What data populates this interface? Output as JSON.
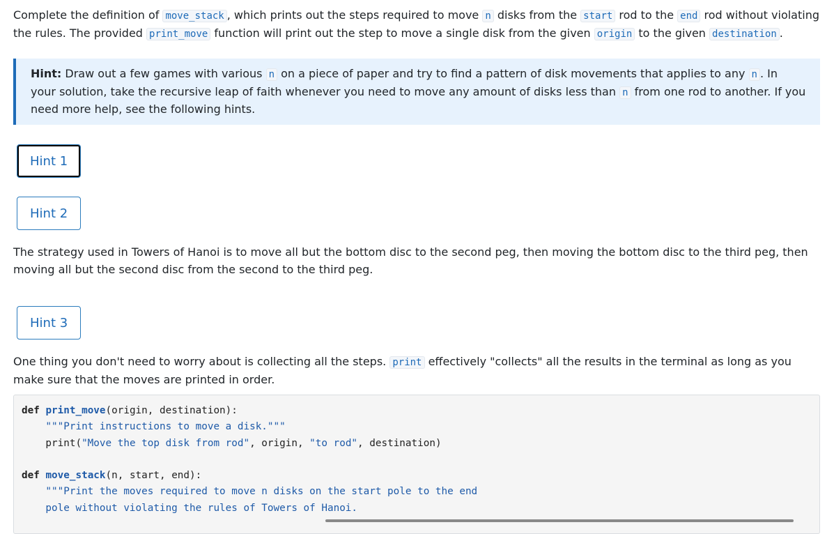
{
  "intro": {
    "t1": "Complete the definition of ",
    "c1": "move_stack",
    "t2": ", which prints out the steps required to move ",
    "c2": "n",
    "t3": " disks from the ",
    "c3": "start",
    "t4": " rod to the ",
    "c4": "end",
    "t5": " rod without violating the rules. The provided ",
    "c5": "print_move",
    "t6": " function will print out the step to move a single disk from the given ",
    "c6": "origin",
    "t7": " to the given ",
    "c7": "destination",
    "t8": "."
  },
  "hint": {
    "label": "Hint:",
    "t1": " Draw out a few games with various ",
    "c1": "n",
    "t2": " on a piece of paper and try to find a pattern of disk movements that applies to any ",
    "c2": "n",
    "t3": ". In your solution, take the recursive leap of faith whenever you need to move any amount of disks less than ",
    "c3": "n",
    "t4": " from one rod to another. If you need more help, see the following hints."
  },
  "buttons": {
    "hint1": "Hint 1",
    "hint2": "Hint 2",
    "hint3": "Hint 3"
  },
  "hint2_text": "The strategy used in Towers of Hanoi is to move all but the bottom disc to the second peg, then moving the bottom disc to the third peg, then moving all but the second disc from the second to the third peg.",
  "hint3_text": {
    "t1": "One thing you don't need to worry about is collecting all the steps. ",
    "c1": "print",
    "t2": " effectively \"collects\" all the results in the terminal as long as you make sure that the moves are printed in order."
  },
  "code": {
    "l1_kw": "def",
    "l1_fn": "print_move",
    "l1_rest": "(origin, destination):",
    "l2": "    \"\"\"Print instructions to move a disk.\"\"\"",
    "l3_a": "    print(",
    "l3_s1": "\"Move the top disk from rod\"",
    "l3_b": ", origin, ",
    "l3_s2": "\"to rod\"",
    "l3_c": ", destination)",
    "l5_kw": "def",
    "l5_fn": "move_stack",
    "l5_rest": "(n, start, end):",
    "l6": "    \"\"\"Print the moves required to move n disks on the start pole to the end",
    "l7": "    pole without violating the rules of Towers of Hanoi."
  }
}
